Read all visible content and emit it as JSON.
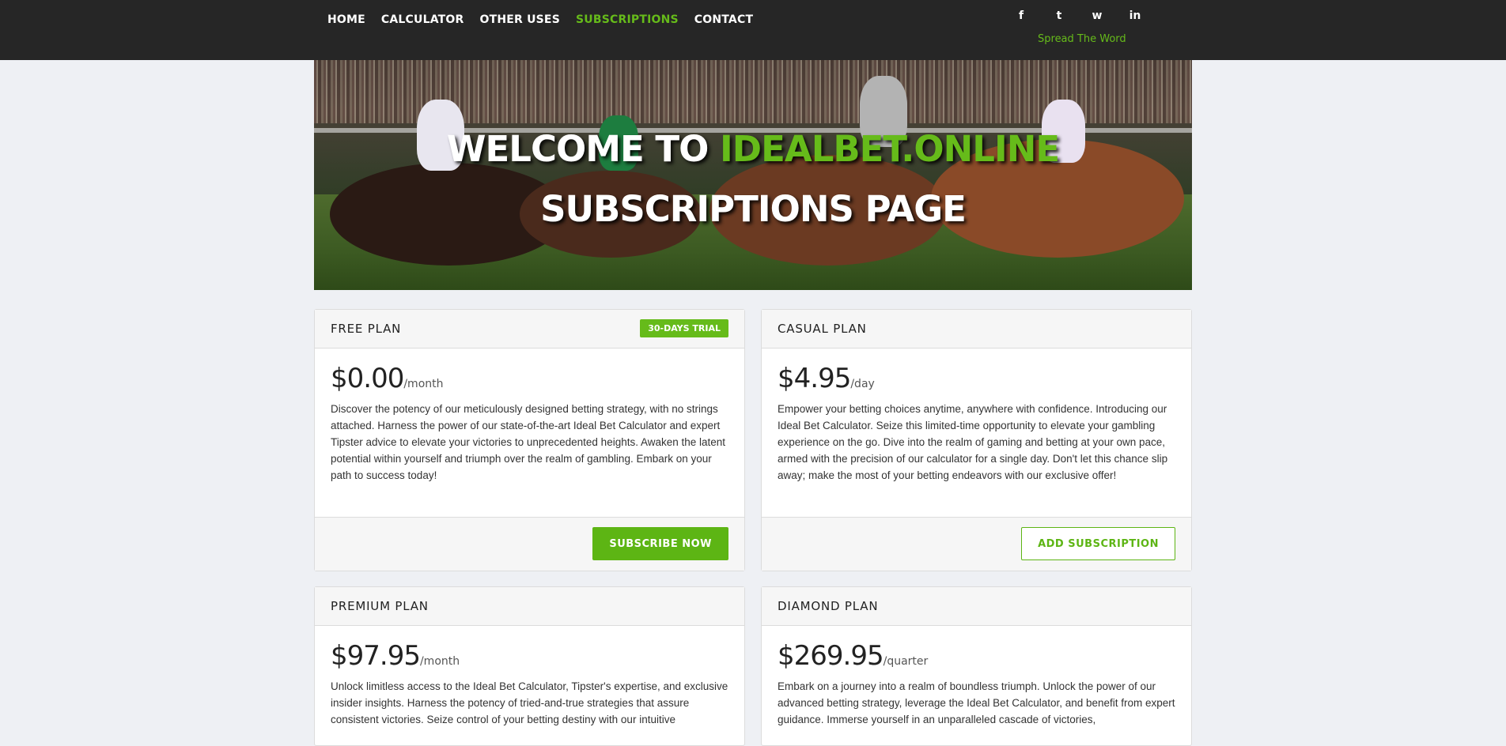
{
  "nav": {
    "items": [
      {
        "label": "HOME"
      },
      {
        "label": "CALCULATOR"
      },
      {
        "label": "OTHER USES"
      },
      {
        "label": "SUBSCRIPTIONS",
        "active": true
      },
      {
        "label": "CONTACT"
      }
    ]
  },
  "social": {
    "icons": [
      "facebook-icon",
      "twitter-icon",
      "whatsapp-icon",
      "linkedin-icon"
    ],
    "glyphs": [
      "f",
      "t",
      "w",
      "in"
    ],
    "tagline": "Spread The Word"
  },
  "hero": {
    "line1_prefix": "WELCOME TO ",
    "line1_brand": "IDEALBET.ONLINE",
    "line2": "SUBSCRIPTIONS PAGE"
  },
  "colors": {
    "accent": "#66bb1a",
    "topbar": "#262626",
    "background": "#eef0f4"
  },
  "plans": [
    {
      "title": "FREE PLAN",
      "badge": "30-DAYS TRIAL",
      "price": "$0.00",
      "period": "/month",
      "description": "Discover the potency of our meticulously designed betting strategy, with no strings attached. Harness the power of our state-of-the-art Ideal Bet Calculator and expert Tipster advice to elevate your victories to unprecedented heights. Awaken the latent potential within yourself and triumph over the realm of gambling. Embark on your path to success today!",
      "button": "SUBSCRIBE NOW"
    },
    {
      "title": "CASUAL PLAN",
      "price": "$4.95",
      "period": "/day",
      "description": "Empower your betting choices anytime, anywhere with confidence. Introducing our Ideal Bet Calculator. Seize this limited-time opportunity to elevate your gambling experience on the go. Dive into the realm of gaming and betting at your own pace, armed with the precision of our calculator for a single day. Don't let this chance slip away; make the most of your betting endeavors with our exclusive offer!",
      "button": "ADD SUBSCRIPTION"
    },
    {
      "title": "PREMIUM PLAN",
      "price": "$97.95",
      "period": "/month",
      "description": "Unlock limitless access to the Ideal Bet Calculator, Tipster's expertise, and exclusive insider insights. Harness the potency of tried-and-true strategies that assure consistent victories. Seize control of your betting destiny with our intuitive"
    },
    {
      "title": "DIAMOND PLAN",
      "price": "$269.95",
      "period": "/quarter",
      "description": "Embark on a journey into a realm of boundless triumph. Unlock the power of our advanced betting strategy, leverage the Ideal Bet Calculator, and benefit from expert guidance. Immerse yourself in an unparalleled cascade of victories,"
    }
  ]
}
